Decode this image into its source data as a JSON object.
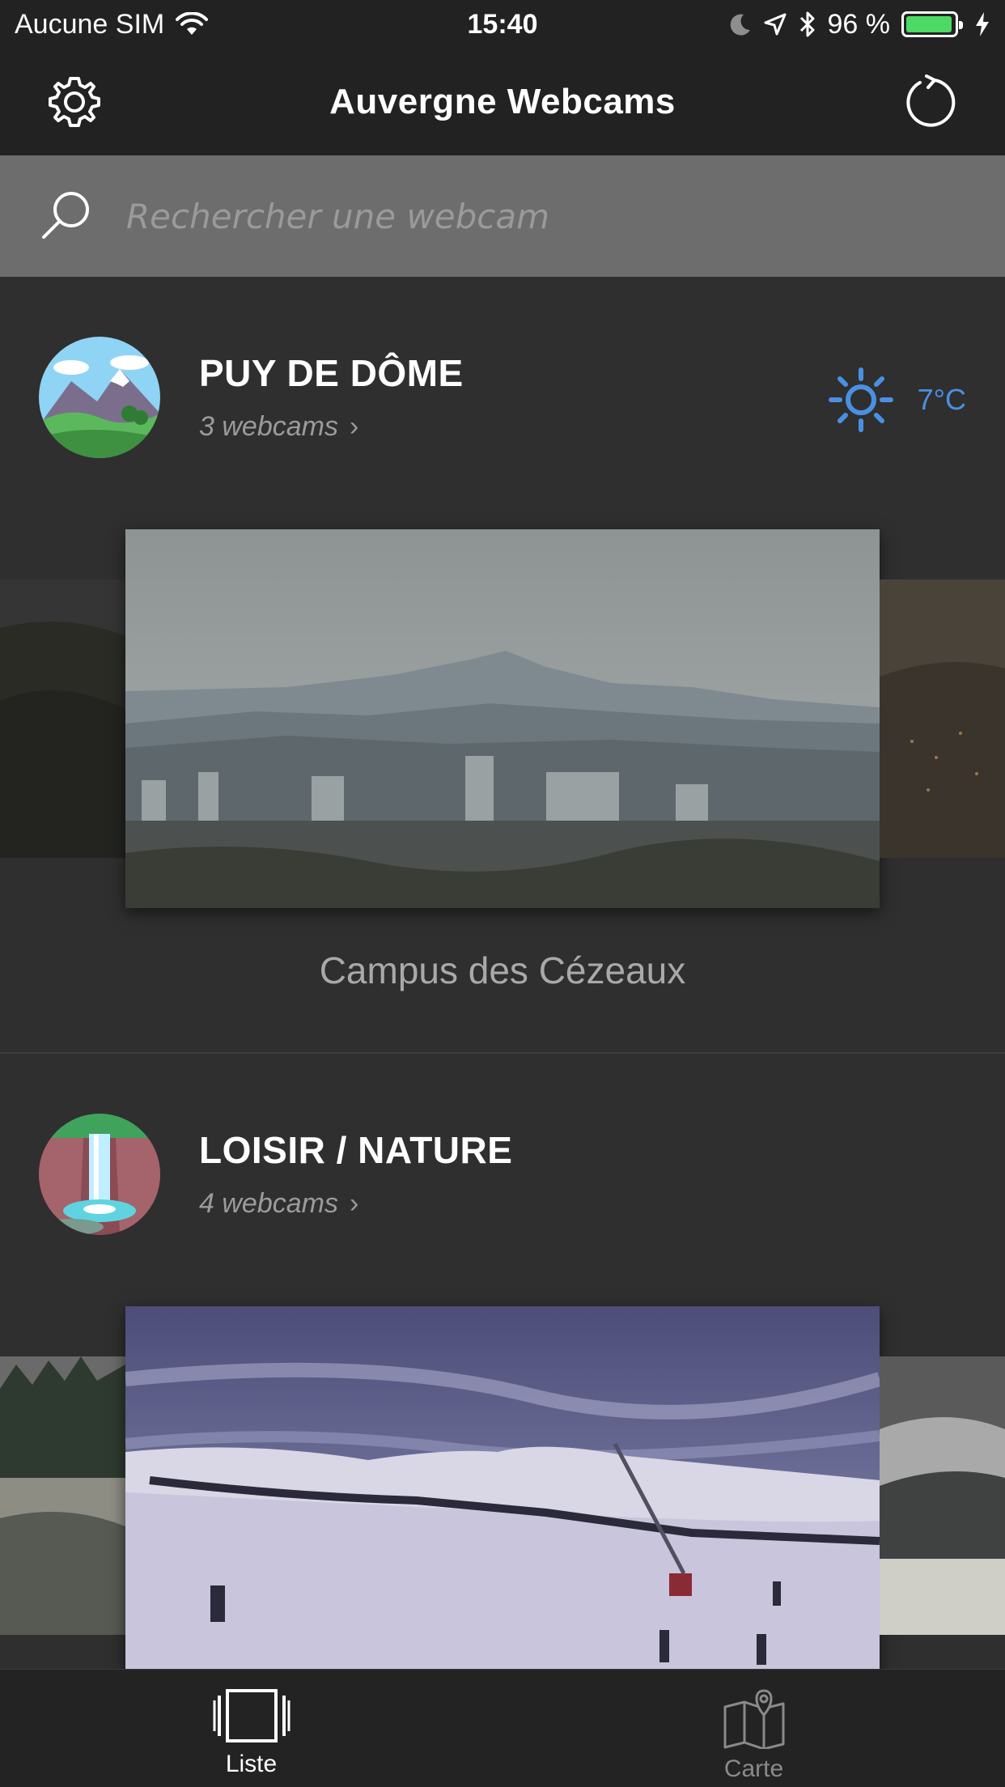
{
  "status_bar": {
    "carrier": "Aucune SIM",
    "time": "15:40",
    "battery_percent": "96 %",
    "battery_level": 0.96,
    "battery_color": "#4cd964"
  },
  "nav": {
    "title": "Auvergne Webcams",
    "left_icon": "gear-icon",
    "right_icon": "refresh-icon"
  },
  "search": {
    "placeholder": "Rechercher une webcam",
    "value": ""
  },
  "sections": [
    {
      "title": "PUY DE DÔME",
      "count": "3 webcams",
      "chevron": "›",
      "weather": {
        "icon": "sun-icon",
        "temp": "7°C",
        "color": "#4a90e2"
      },
      "current_webcam": "Campus des Cézeaux"
    },
    {
      "title": "LOISIR / NATURE",
      "count": "4 webcams",
      "chevron": "›"
    }
  ],
  "tabs": [
    {
      "label": "Liste",
      "icon": "list-cards-icon",
      "active": true
    },
    {
      "label": "Carte",
      "icon": "map-icon",
      "active": false
    }
  ]
}
